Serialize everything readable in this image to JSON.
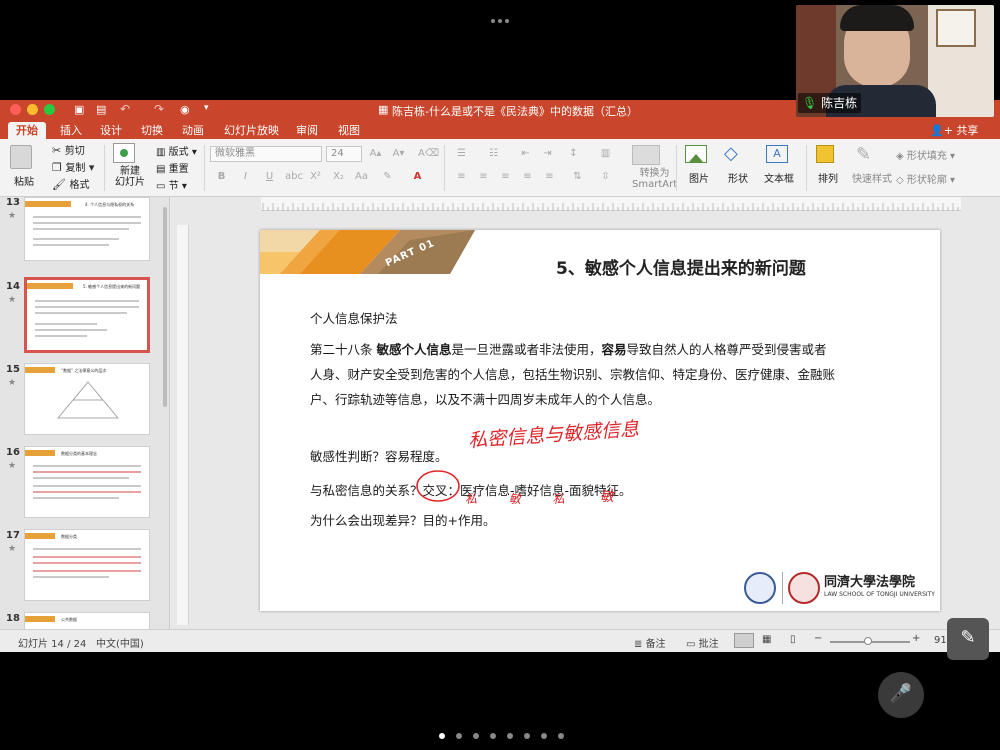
{
  "window": {
    "title": "陈吉栋-什么是或不是《民法典》中的数据（汇总）",
    "share_label": "共享"
  },
  "ribbon_tabs": [
    "开始",
    "插入",
    "设计",
    "切换",
    "动画",
    "幻灯片放映",
    "审阅",
    "视图"
  ],
  "ribbon": {
    "paste": "粘贴",
    "cut": "剪切",
    "copy": "复制",
    "format": "格式",
    "new_slide": "新建\n幻灯片",
    "layout": "版式",
    "reset": "重置",
    "section": "节",
    "font_name": "微软雅黑",
    "font_size": "24",
    "convert_smartart": "转换为\nSmartArt",
    "picture": "图片",
    "shape": "形状",
    "textbox": "文本框",
    "arrange": "排列",
    "quick_styles": "快速样式",
    "shape_fill": "形状填充",
    "shape_outline": "形状轮廓"
  },
  "thumbnails": [
    {
      "num": "13",
      "title": "4. 个人信息与隐私权的关系"
    },
    {
      "num": "14",
      "title": "5. 敏感个人信息提出来的新问题",
      "selected": true
    },
    {
      "num": "15",
      "title": "“数据” 之法律意义的层次"
    },
    {
      "num": "16",
      "title": "数据分类的基本理念"
    },
    {
      "num": "17",
      "title": "数据分类"
    },
    {
      "num": "18",
      "title": "公共数据"
    }
  ],
  "slide": {
    "part_label": "PART 01",
    "title": "5、敏感个人信息提出来的新问题",
    "law_name": "个人信息保护法",
    "para_line1_a": "第二十八条 ",
    "para_line1_b": "敏感个人信息",
    "para_line1_c": "是一旦泄露或者非法使用，",
    "para_line1_d": "容易",
    "para_line1_e": "导致自然人的人格尊严受到侵害或者",
    "para_line2": "人身、财产安全受到危害的个人信息，包括生物识别、宗教信仰、特定身份、医疗健康、金融账",
    "para_line3": "户、行踪轨迹等信息，以及不满十四周岁未成年人的个人信息。",
    "line_sensitivity": "敏感性判断？容易程度。",
    "line_relation_a": "与私密信息的关系？",
    "line_relation_b": "交叉",
    "line_relation_c": "：医疗信息-嗜好信息-面貌特征。",
    "line_why": "为什么会出现差异？目的+作用。",
    "handwriting_1": "私密信息与敏感信息",
    "handwriting_2": "私 敏 私",
    "handwriting_3": "敏",
    "school_logo_text": "同濟大學法學院",
    "school_sub": "LAW SCHOOL OF TONGJI UNIVERSITY"
  },
  "status": {
    "slide_counter": "幻灯片 14 / 24",
    "language": "中文(中国)",
    "notes": "备注",
    "comments": "批注",
    "zoom": "91%"
  },
  "video": {
    "participant_name": "陈吉栋"
  },
  "colors": {
    "accent": "#c9452b",
    "handwriting": "#e0242a",
    "selected_thumb": "#d9534f"
  }
}
